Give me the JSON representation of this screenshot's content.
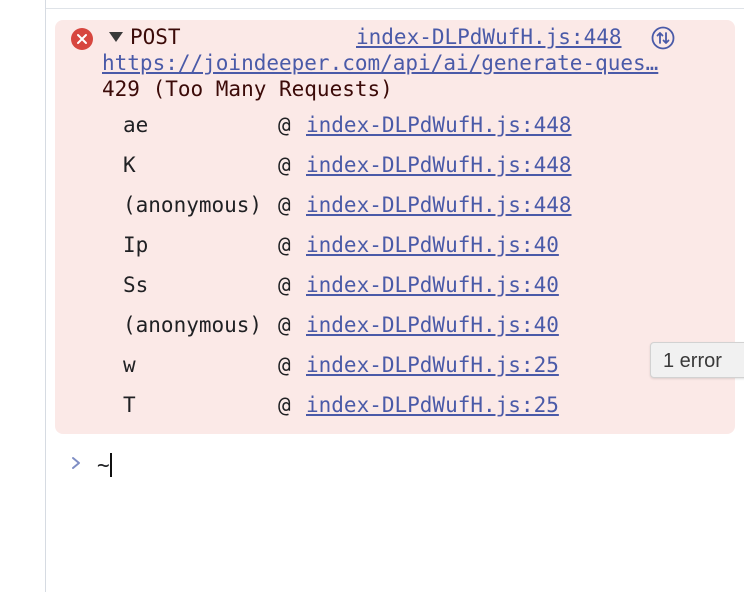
{
  "error": {
    "method": "POST",
    "source": "index-DLPdWufH.js:448",
    "url": "https://joindeeper.com/api/ai/generate-ques…",
    "status": "429 (Too Many Requests)",
    "icons": {
      "error": "error-circle-icon",
      "expand": "triangle-down-icon",
      "network": "network-request-icon"
    },
    "colors": {
      "background": "#fbe9e7",
      "icon": "#d7463f",
      "link": "#4a5aa8",
      "text": "#3b0a08"
    }
  },
  "stack": [
    {
      "fn": "ae",
      "at": "@",
      "source": "index-DLPdWufH.js:448"
    },
    {
      "fn": "K",
      "at": "@",
      "source": "index-DLPdWufH.js:448"
    },
    {
      "fn": "(anonymous)",
      "at": "@",
      "source": "index-DLPdWufH.js:448"
    },
    {
      "fn": "Ip",
      "at": "@",
      "source": "index-DLPdWufH.js:40"
    },
    {
      "fn": "Ss",
      "at": "@",
      "source": "index-DLPdWufH.js:40"
    },
    {
      "fn": "(anonymous)",
      "at": "@",
      "source": "index-DLPdWufH.js:40"
    },
    {
      "fn": "w",
      "at": "@",
      "source": "index-DLPdWufH.js:25"
    },
    {
      "fn": "T",
      "at": "@",
      "source": "index-DLPdWufH.js:25"
    }
  ],
  "tooltip": {
    "text": "1 error"
  },
  "prompt": {
    "icon": "chevron-right-icon",
    "value": "~"
  }
}
